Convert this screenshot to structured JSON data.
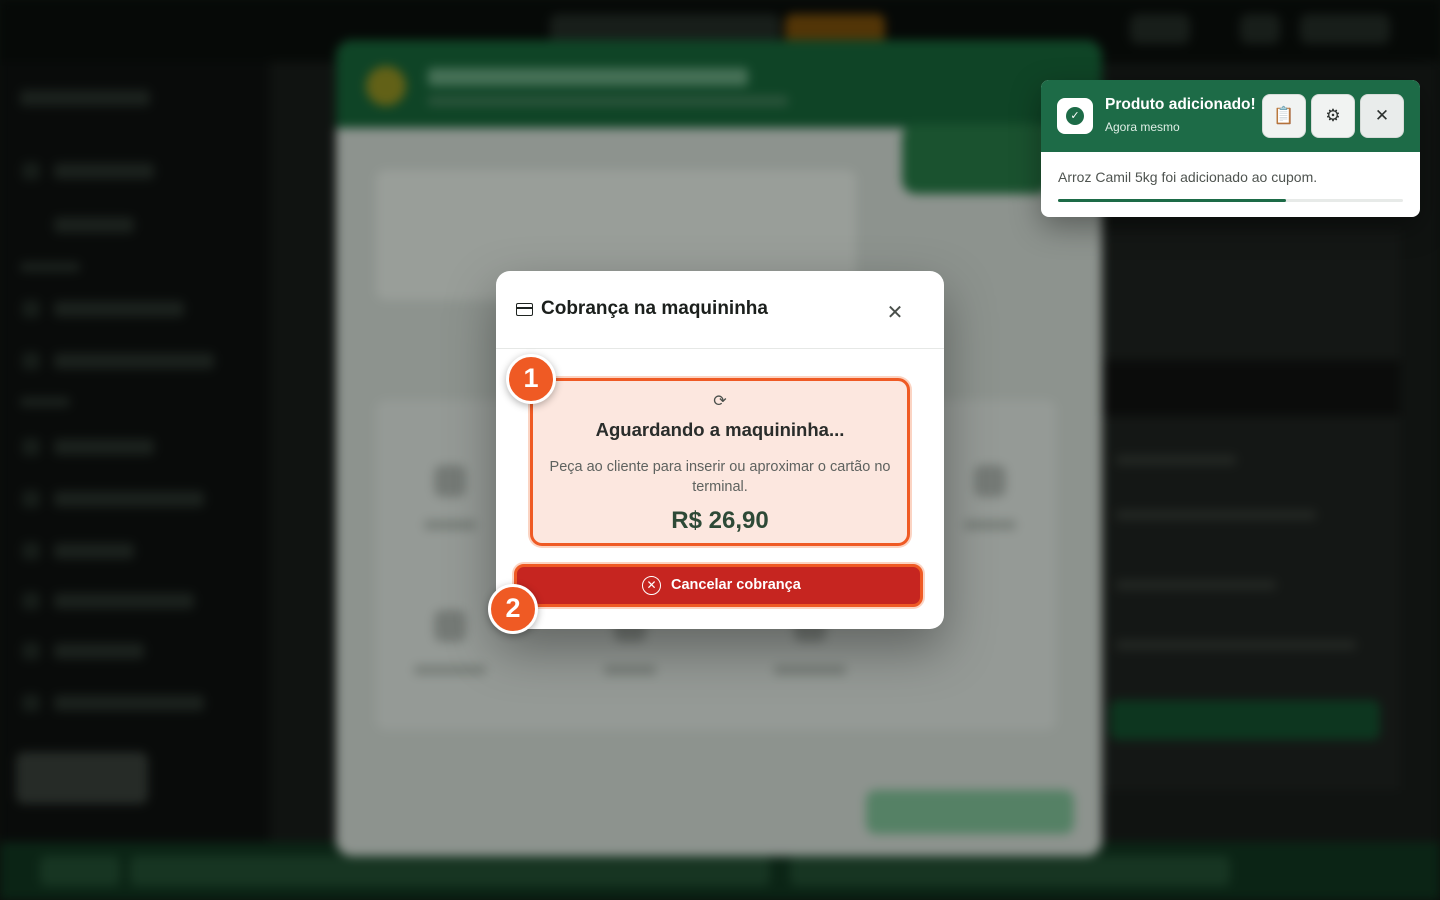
{
  "charge_modal": {
    "title": "Cobrança na maquininha",
    "close_glyph": "✕",
    "status": {
      "spinner_glyph": "⟳",
      "title": "Aguardando a maquininha...",
      "description": "Peça ao cliente para inserir ou aproximar o cartão no terminal.",
      "amount": "R$ 26,90"
    },
    "cancel_button": {
      "label": "Cancelar cobrança",
      "icon_glyph": "✕"
    }
  },
  "step_badges": [
    {
      "label": "1"
    },
    {
      "label": "2"
    }
  ],
  "toast": {
    "title": "Produto adicionado!",
    "time": "Agora mesmo",
    "message": "Arroz Camil 5kg foi adicionado ao cupom.",
    "check_glyph": "✓",
    "buttons": {
      "copy_glyph": "📋",
      "settings_glyph": "⚙",
      "close_glyph": "✕"
    },
    "progress": 0.66
  },
  "colors": {
    "accent_orange": "#ef5a24",
    "cancel_red": "#c62520",
    "brand_green": "#1d6b47",
    "status_bg": "#fce7df"
  }
}
